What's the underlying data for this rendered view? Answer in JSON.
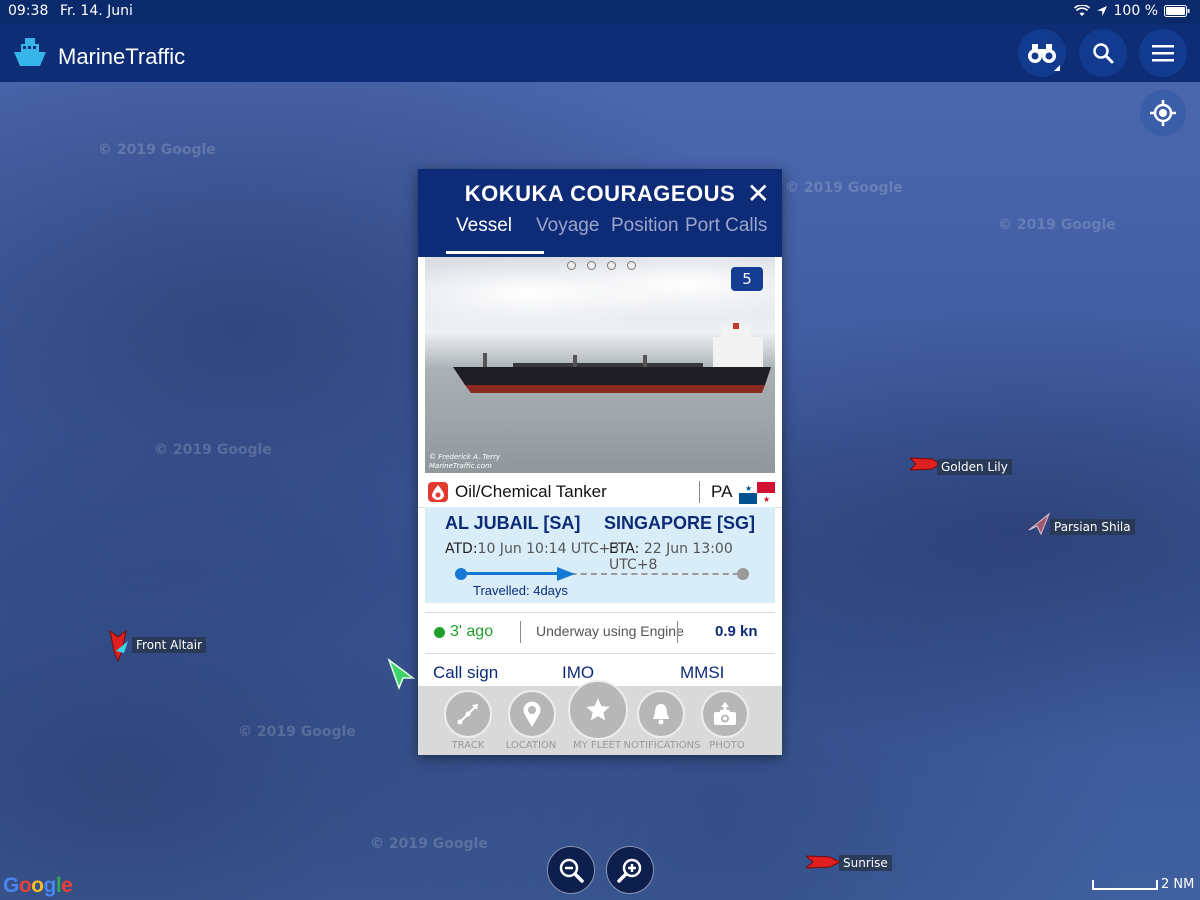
{
  "status_bar": {
    "time": "09:38",
    "date": "Fr. 14. Juni",
    "battery": "100 %"
  },
  "app": {
    "title": "MarineTraffic",
    "logo_icon": "ship-icon"
  },
  "header_buttons": [
    {
      "name": "binoculars-icon"
    },
    {
      "name": "search-icon"
    },
    {
      "name": "menu-icon"
    }
  ],
  "map": {
    "watermark": "© 2019 Google",
    "google_logo": "Google",
    "scale_label": "2 NM",
    "ships": [
      {
        "name": "Golden Lily",
        "color": "#e02020"
      },
      {
        "name": "Parsian Shila",
        "color": "#a05a70"
      },
      {
        "name": "Front Altair",
        "color": "#e02020"
      },
      {
        "name": "Sunrise",
        "color": "#e02020"
      }
    ]
  },
  "vessel_card": {
    "name": "KOKUKA COURAGEOUS",
    "tabs": [
      "Vessel",
      "Voyage",
      "Position",
      "Port Calls"
    ],
    "active_tab": "Vessel",
    "photo": {
      "count": "5",
      "credit_line1": "© Frederick A. Terry",
      "credit_line2": "MarineTraffic.com",
      "pages": 4
    },
    "type": "Oil/Chemical Tanker",
    "flag_code": "PA",
    "from_port": "AL JUBAIL [SA]",
    "to_port": "SINGAPORE [SG]",
    "atd_label": "ATD:",
    "atd_value": "10 Jun 10:14 UTC+3",
    "eta_label": "ETA:",
    "eta_value": "22 Jun 13:00 UTC+8",
    "travelled": "Travelled: 4days",
    "progress": 0.4,
    "last_seen": "3' ago",
    "nav_status": "Underway using Engine",
    "speed": "0.9 kn",
    "id_labels": [
      "Call sign",
      "IMO",
      "MMSI"
    ],
    "actions": [
      {
        "label": "TRACK",
        "icon": "track-icon"
      },
      {
        "label": "LOCATION",
        "icon": "location-pin-icon"
      },
      {
        "label": "MY FLEET",
        "icon": "star-icon"
      },
      {
        "label": "NOTIFICATIONS",
        "icon": "bell-icon"
      },
      {
        "label": "PHOTO",
        "icon": "camera-upload-icon"
      }
    ]
  }
}
